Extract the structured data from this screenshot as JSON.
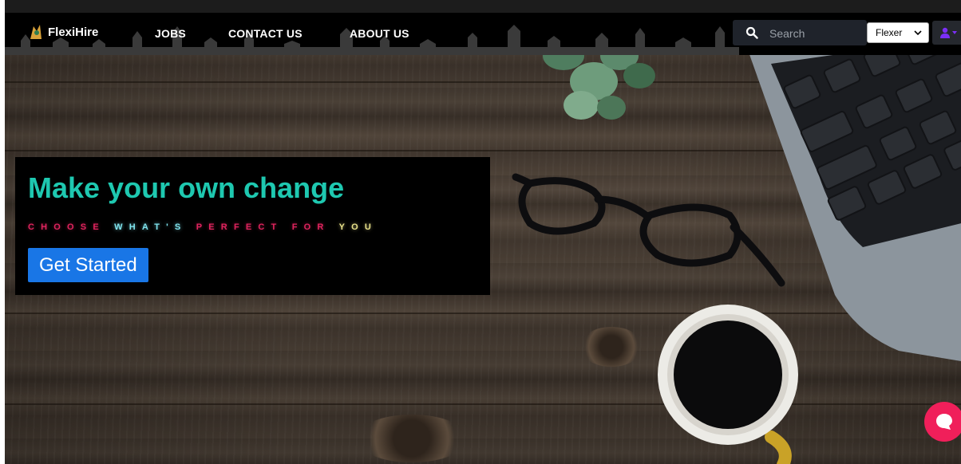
{
  "colors": {
    "nav_bg": "#000000",
    "accent_teal": "#1ec8b0",
    "tag_pink": "#e0245e",
    "tag_teal": "#7fe4ee",
    "button_blue": "#1976e6",
    "chat_pink": "#f01f5a"
  },
  "navbar": {
    "logo_text": "FlexiHire",
    "links": [
      {
        "label": "JOBS"
      },
      {
        "label": "CONTACT US"
      },
      {
        "label": "ABOUT US"
      }
    ],
    "search": {
      "placeholder": "Search",
      "icon": "search-icon"
    },
    "role_select": {
      "selected": "Flexer",
      "icon": "chevron-down-icon"
    },
    "user_menu": {
      "icon": "user-icon"
    }
  },
  "hero": {
    "title": "Make your own change",
    "tagline_parts": [
      "CHOOSE ",
      "WHAT'S",
      " ",
      "PERFECT FOR ",
      "YOU"
    ],
    "cta_label": "Get Started"
  },
  "chat": {
    "icon": "chat-bubble-icon"
  }
}
